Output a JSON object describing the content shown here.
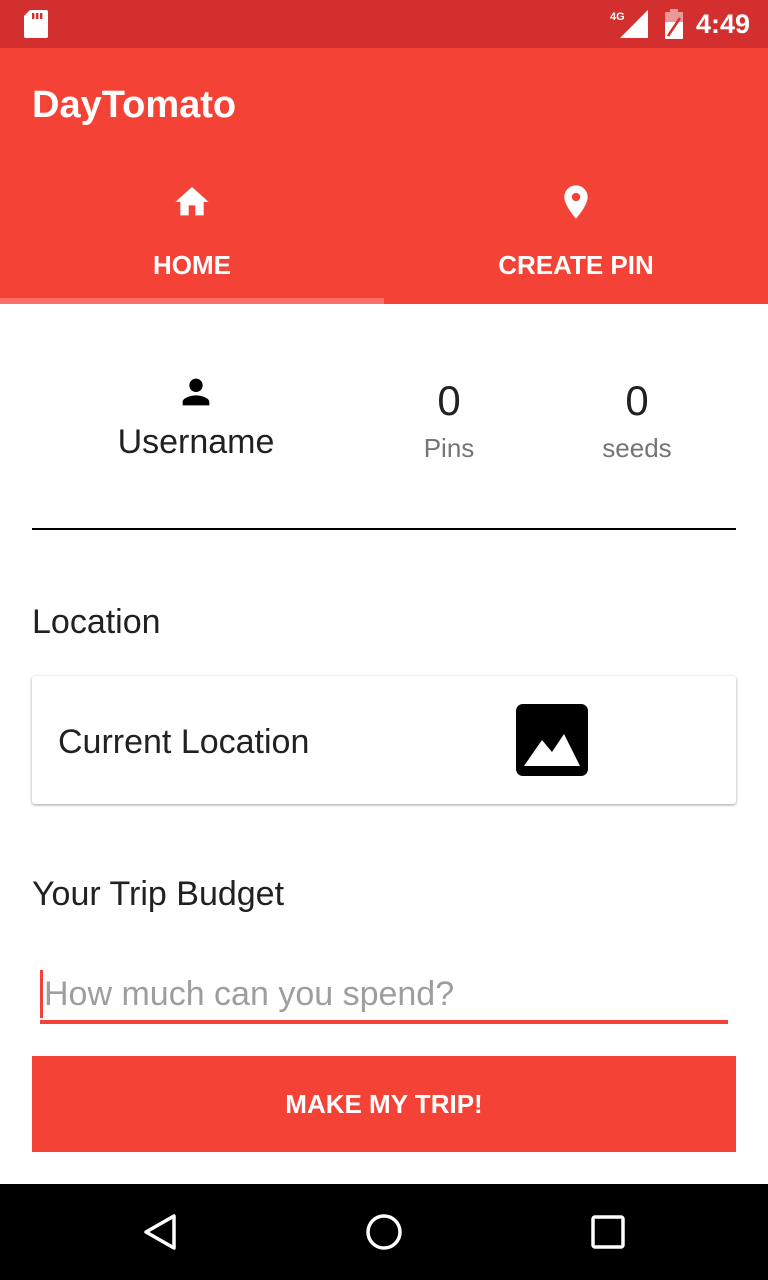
{
  "status_bar": {
    "network_label": "4G",
    "time": "4:49",
    "icons": [
      "sd-card-icon",
      "signal-icon",
      "battery-icon"
    ]
  },
  "app": {
    "title": "DayTomato",
    "accent_color": "#f44336",
    "status_color": "#d32f2f"
  },
  "tabs": [
    {
      "label": "HOME",
      "icon": "home-icon",
      "selected": true
    },
    {
      "label": "CREATE PIN",
      "icon": "location-pin-icon",
      "selected": false
    }
  ],
  "profile": {
    "icon": "person-icon",
    "username": "Username",
    "stats": [
      {
        "value": "0",
        "label": "Pins"
      },
      {
        "value": "0",
        "label": "seeds"
      }
    ]
  },
  "location": {
    "heading": "Location",
    "card_text": "Current Location",
    "card_icon": "image-icon"
  },
  "budget": {
    "heading": "Your Trip Budget",
    "input_value": "",
    "placeholder": "How much can you spend?"
  },
  "action": {
    "button_label": "MAKE MY TRIP!"
  },
  "nav_bar": {
    "icons": [
      "back-icon",
      "home-nav-icon",
      "recents-icon"
    ]
  }
}
